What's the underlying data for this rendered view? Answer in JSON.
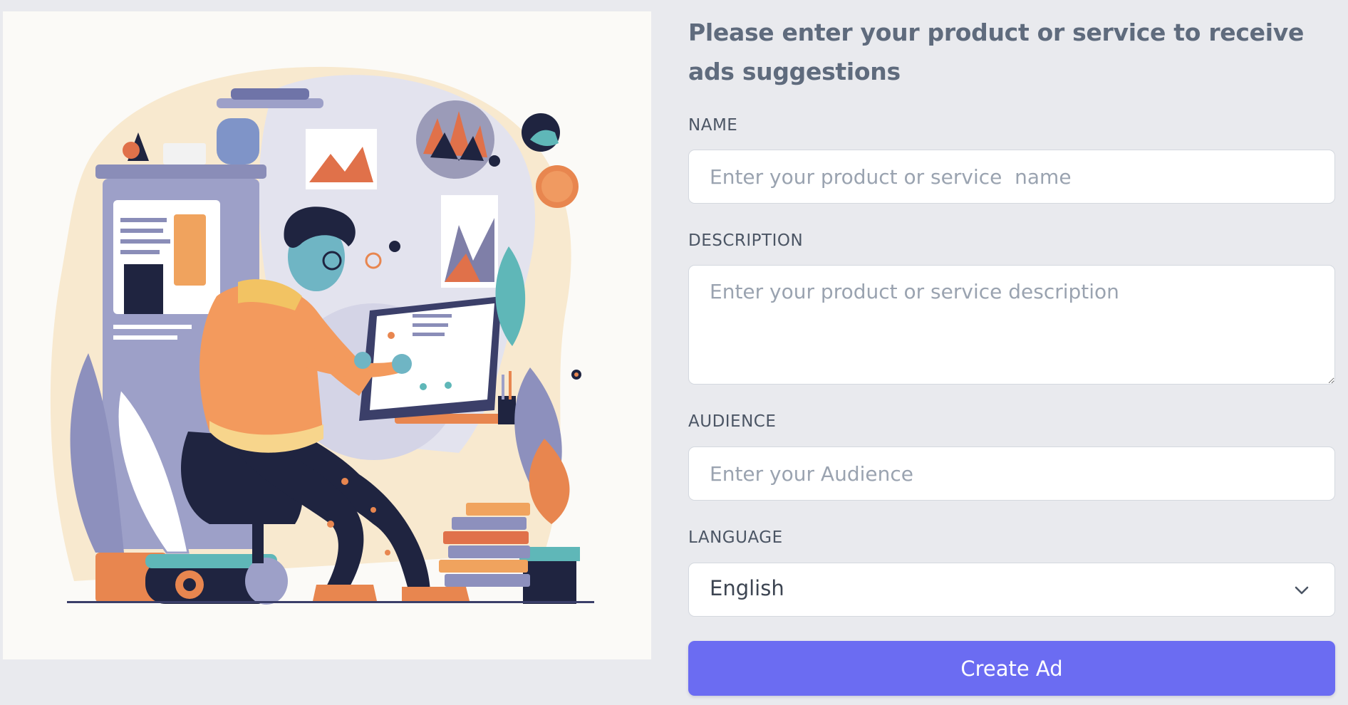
{
  "illustration": {
    "icon": "person-drawing-at-tablet-illustration"
  },
  "form": {
    "heading": "Please enter your product or service to receive ads suggestions",
    "name": {
      "label": "NAME",
      "value": "",
      "placeholder": "Enter your product or service  name"
    },
    "description": {
      "label": "DESCRIPTION",
      "value": "",
      "placeholder": "Enter your product or service description"
    },
    "audience": {
      "label": "AUDIENCE",
      "value": "",
      "placeholder": "Enter your Audience"
    },
    "language": {
      "label": "LANGUAGE",
      "selected": "English",
      "icon": "chevron-down-icon"
    },
    "submit_label": "Create Ad"
  },
  "colors": {
    "background": "#e9eaee",
    "accent": "#6b6cf2",
    "heading": "#5f6b7d",
    "label": "#4b5564"
  }
}
